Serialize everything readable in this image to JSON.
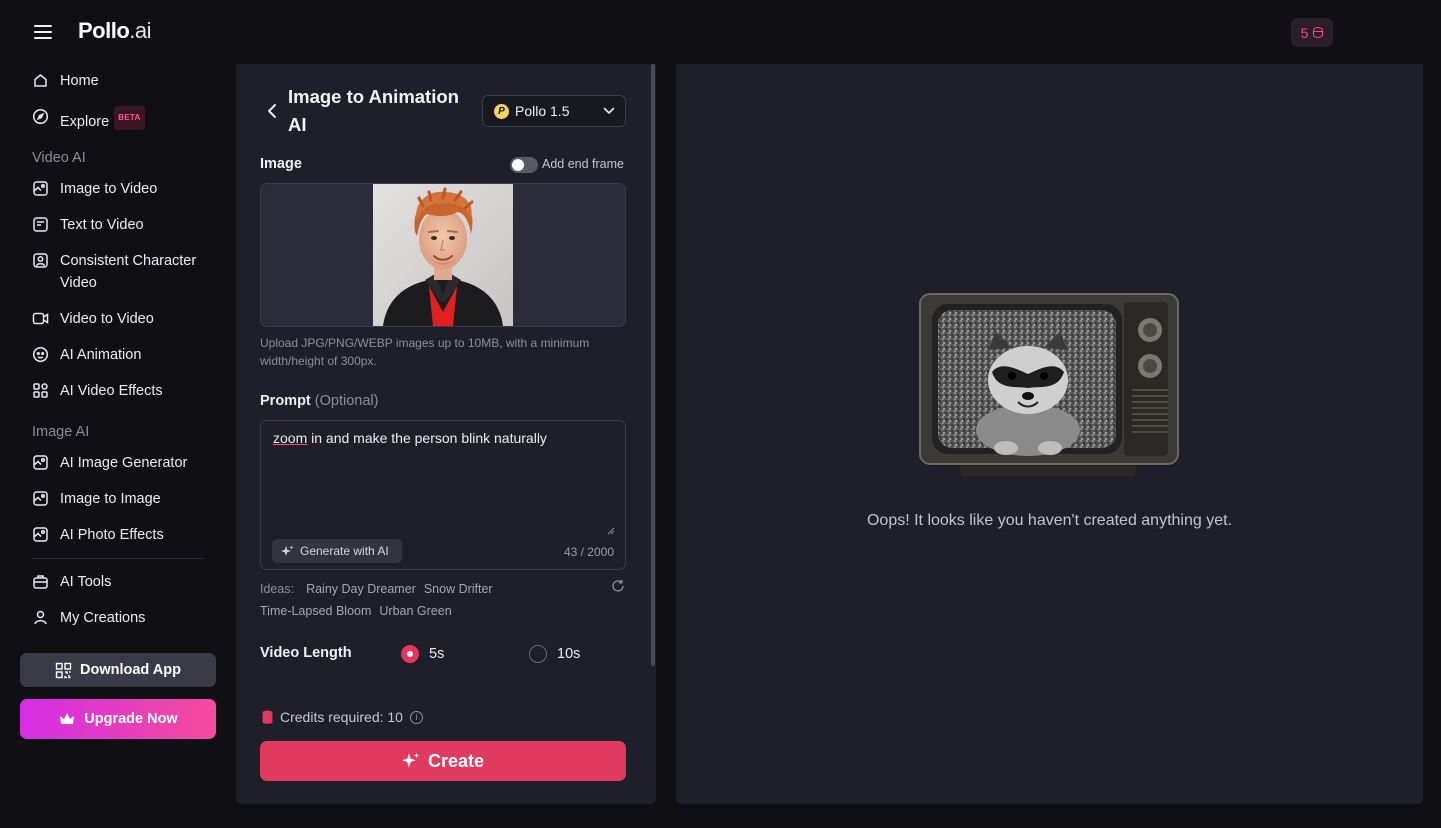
{
  "header": {
    "logo_main": "Pollo",
    "logo_suffix": ".ai",
    "credits": "5"
  },
  "sidebar": {
    "home": "Home",
    "explore": "Explore",
    "explore_badge": "BETA",
    "video_ai_label": "Video AI",
    "image_to_video": "Image to Video",
    "text_to_video": "Text to Video",
    "consistent_character_line1": "Consistent Character",
    "consistent_character_line2": "Video",
    "video_to_video": "Video to Video",
    "ai_animation": "AI Animation",
    "ai_video_effects": "AI Video Effects",
    "image_ai_label": "Image AI",
    "ai_image_generator": "AI Image Generator",
    "image_to_image": "Image to Image",
    "ai_photo_effects": "AI Photo Effects",
    "ai_tools": "AI Tools",
    "my_creations": "My Creations",
    "download_app": "Download App",
    "upgrade_now": "Upgrade Now"
  },
  "form": {
    "title_line1": "Image to Animation",
    "title_line2": "AI",
    "model": "Pollo 1.5",
    "model_logo_letter": "P",
    "image_label": "Image",
    "end_frame_label": "Add end frame",
    "end_frame_enabled": false,
    "upload_hint": "Upload JPG/PNG/WEBP images up to 10MB, with a minimum width/height of 300px.",
    "prompt_label": "Prompt",
    "prompt_optional": "(Optional)",
    "prompt_first_word": "zoom",
    "prompt_rest": " in and make the person blink naturally",
    "generate_ai": "Generate with AI",
    "char_count": "43 / 2000",
    "ideas_label": "Ideas:",
    "ideas": [
      "Rainy Day Dreamer",
      "Snow Drifter",
      "Time-Lapsed Bloom",
      "Urban Green"
    ],
    "video_length_label": "Video Length",
    "length_options": [
      "5s",
      "10s"
    ],
    "selected_length": "5s",
    "credits_required": "Credits required: 10",
    "create": "Create"
  },
  "result": {
    "empty_message": "Oops! It looks like you haven't created anything yet."
  },
  "colors": {
    "accent": "#e03a5f",
    "upgrade_gradient_start": "#d42ee6",
    "upgrade_gradient_end": "#f54b9b",
    "panel_bg": "#1f1f29",
    "page_bg": "#0f0f14"
  }
}
